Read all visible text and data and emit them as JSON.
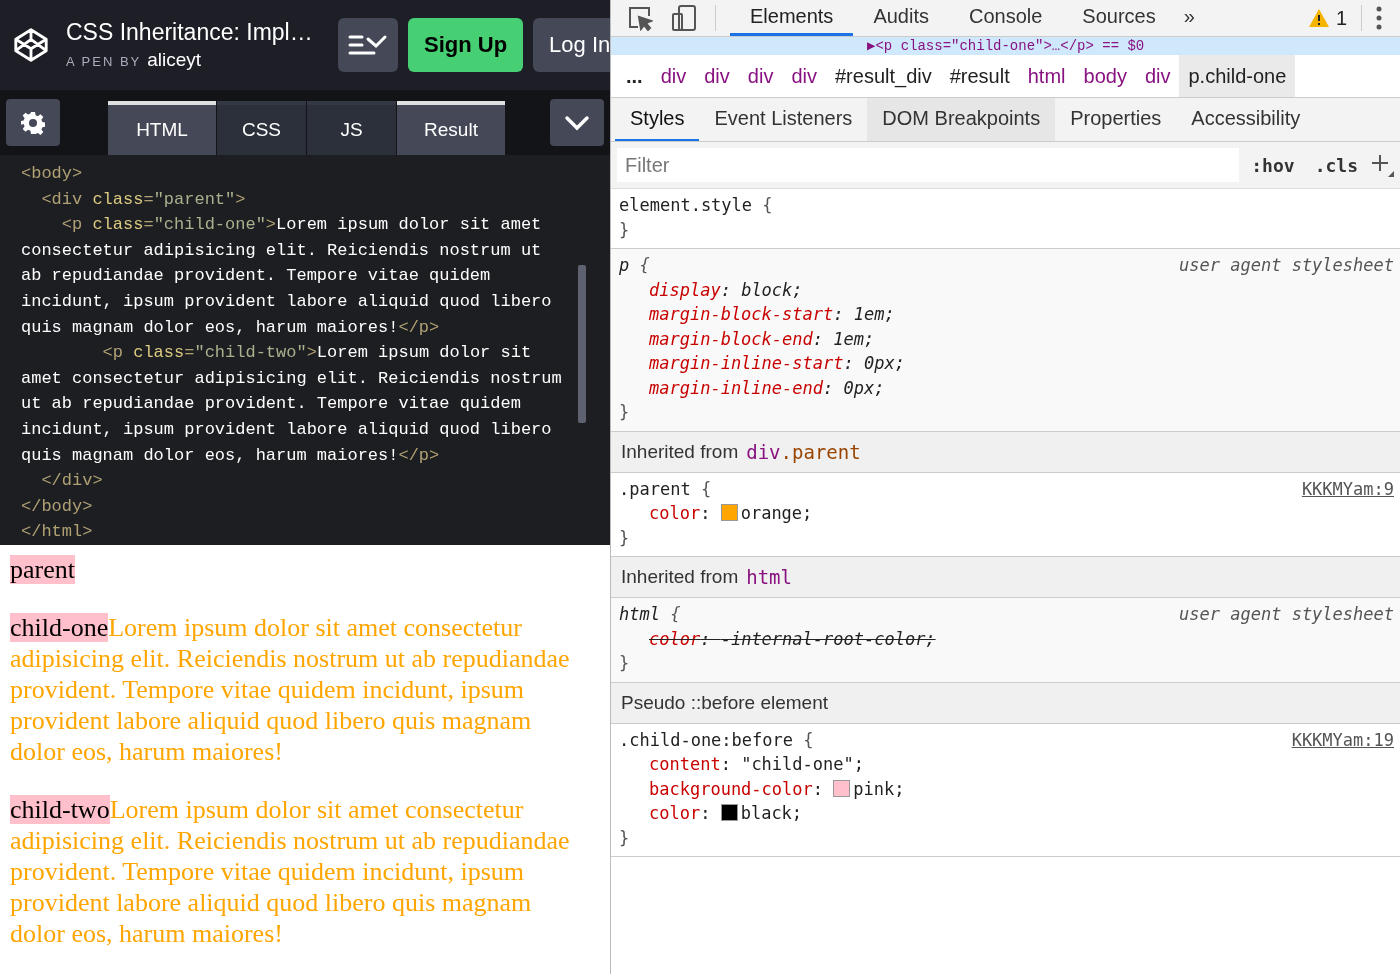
{
  "pen": {
    "title": "CSS Inheritance: Impl…",
    "byline": "A PEN BY",
    "author": "aliceyt"
  },
  "header_buttons": [
    {
      "kind": "layout"
    },
    {
      "kind": "signup",
      "label": "Sign Up"
    },
    {
      "kind": "login",
      "label": "Log In"
    }
  ],
  "editor_tabs": [
    {
      "label": "HTML",
      "selected": true
    },
    {
      "label": "CSS",
      "selected": false
    },
    {
      "label": "JS",
      "selected": false
    },
    {
      "label": "Result",
      "selected": true
    }
  ],
  "code_lines": [
    [
      {
        "kind": "tag",
        "text": "<body>"
      }
    ],
    [
      {
        "kind": "tag",
        "text": "  <div "
      },
      {
        "kind": "attr",
        "text": "class"
      },
      {
        "kind": "tag",
        "text": "="
      },
      {
        "kind": "value",
        "text": "\"parent\""
      },
      {
        "kind": "tag",
        "text": ">"
      }
    ],
    [
      {
        "kind": "tag",
        "text": "    <p "
      },
      {
        "kind": "attr",
        "text": "class"
      },
      {
        "kind": "tag",
        "text": "="
      },
      {
        "kind": "value",
        "text": "\"child-one\""
      },
      {
        "kind": "tag",
        "text": ">"
      },
      {
        "kind": "text",
        "text": "Lorem ipsum dolor sit amet"
      }
    ],
    [
      {
        "kind": "text",
        "text": "consectetur adipisicing elit. Reiciendis nostrum ut"
      }
    ],
    [
      {
        "kind": "text",
        "text": "ab repudiandae provident. Tempore vitae quidem"
      }
    ],
    [
      {
        "kind": "text",
        "text": "incidunt, ipsum provident labore aliquid quod libero"
      }
    ],
    [
      {
        "kind": "text",
        "text": "quis magnam dolor eos, harum maiores!"
      },
      {
        "kind": "tag",
        "text": "</p>"
      }
    ],
    [
      {
        "kind": "tag",
        "text": "        <p "
      },
      {
        "kind": "attr",
        "text": "class"
      },
      {
        "kind": "tag",
        "text": "="
      },
      {
        "kind": "value",
        "text": "\"child-two\""
      },
      {
        "kind": "tag",
        "text": ">"
      },
      {
        "kind": "text",
        "text": "Lorem ipsum dolor sit"
      }
    ],
    [
      {
        "kind": "text",
        "text": "amet consectetur adipisicing elit. Reiciendis nostrum"
      }
    ],
    [
      {
        "kind": "text",
        "text": "ut ab repudiandae provident. Tempore vitae quidem"
      }
    ],
    [
      {
        "kind": "text",
        "text": "incidunt, ipsum provident labore aliquid quod libero"
      }
    ],
    [
      {
        "kind": "text",
        "text": "quis magnam dolor eos, harum maiores!"
      },
      {
        "kind": "tag",
        "text": "</p>"
      }
    ],
    [
      {
        "kind": "tag",
        "text": "  </div>"
      }
    ],
    [
      {
        "kind": "tag",
        "text": "</body>"
      }
    ],
    [
      {
        "kind": "tag",
        "text": "</html>"
      }
    ]
  ],
  "result": {
    "parent_label": "parent",
    "paragraphs": [
      {
        "label": "child-one",
        "text": "Lorem ipsum dolor sit amet consectetur adipisicing elit. Reiciendis nostrum ut ab repudiandae provident. Tempore vitae quidem incidunt, ipsum provident labore aliquid quod libero quis magnam dolor eos, harum maiores!"
      },
      {
        "label": "child-two",
        "text": "Lorem ipsum dolor sit amet consectetur adipisicing elit. Reiciendis nostrum ut ab repudiandae provident. Tempore vitae quidem incidunt, ipsum provident labore aliquid quod libero quis magnam dolor eos, harum maiores!"
      }
    ]
  },
  "devtools": {
    "tabs": [
      {
        "label": "Elements",
        "selected": true
      },
      {
        "label": "Audits",
        "selected": false
      },
      {
        "label": "Console",
        "selected": false
      },
      {
        "label": "Sources",
        "selected": false
      }
    ],
    "more_tabs": "»",
    "warning_count": "1",
    "dom_line": "▶<p class=\"child-one\">…</p> == $0",
    "breadcrumbs": [
      {
        "kind": "more",
        "label": "...",
        "selected": false
      },
      {
        "kind": "tag",
        "label": "div",
        "selected": false
      },
      {
        "kind": "tag",
        "label": "div",
        "selected": false
      },
      {
        "kind": "tag",
        "label": "div",
        "selected": false
      },
      {
        "kind": "tag",
        "label": "div",
        "selected": false
      },
      {
        "kind": "id",
        "label": "#result_div",
        "selected": false
      },
      {
        "kind": "id",
        "label": "#result",
        "selected": false
      },
      {
        "kind": "tag",
        "label": "html",
        "selected": false
      },
      {
        "kind": "tag",
        "label": "body",
        "selected": false
      },
      {
        "kind": "tag",
        "label": "div",
        "selected": false
      },
      {
        "kind": "id",
        "label": "p.child-one",
        "selected": true
      }
    ],
    "subtabs": [
      {
        "label": "Styles",
        "selected": true,
        "hovered": false
      },
      {
        "label": "Event Listeners",
        "selected": false,
        "hovered": false
      },
      {
        "label": "DOM Breakpoints",
        "selected": false,
        "hovered": true
      },
      {
        "label": "Properties",
        "selected": false,
        "hovered": false
      },
      {
        "label": "Accessibility",
        "selected": false,
        "hovered": false
      }
    ],
    "filter": {
      "placeholder": "Filter",
      "hov": ":hov",
      "cls": ".cls"
    },
    "sections": [
      {
        "kind": "rule",
        "user_agent": false,
        "selector": "element.style",
        "open": "{",
        "close": "}"
      },
      {
        "kind": "rule",
        "user_agent": true,
        "selector": "p",
        "open": "{",
        "close": "}",
        "source": "user agent stylesheet",
        "declarations": [
          {
            "prop": "display",
            "colon": ":",
            "value": "block;",
            "struck": false
          },
          {
            "prop": "margin-block-start",
            "colon": ":",
            "value": "1em;",
            "struck": false
          },
          {
            "prop": "margin-block-end",
            "colon": ":",
            "value": "1em;",
            "struck": false
          },
          {
            "prop": "margin-inline-start",
            "colon": ":",
            "value": "0px;",
            "struck": false
          },
          {
            "prop": "margin-inline-end",
            "colon": ":",
            "value": "0px;",
            "struck": false
          }
        ]
      },
      {
        "kind": "header",
        "label": "Inherited from",
        "element": "div",
        "cls": ".parent"
      },
      {
        "kind": "rule",
        "user_agent": false,
        "selector": ".parent",
        "open": "{",
        "close": "}",
        "source": "KKKMYam:9",
        "declarations": [
          {
            "prop": "color",
            "colon": ":",
            "value": "orange;",
            "color": "#ffa500",
            "struck": false
          }
        ]
      },
      {
        "kind": "header",
        "label": "Inherited from",
        "element": "html"
      },
      {
        "kind": "rule",
        "user_agent": true,
        "selector": "html",
        "open": "{",
        "close": "}",
        "source": "user agent stylesheet",
        "declarations": [
          {
            "prop": "color",
            "colon": ":",
            "value": "-internal-root-color;",
            "struck": true
          }
        ]
      },
      {
        "kind": "header",
        "label": "Pseudo ::before element"
      },
      {
        "kind": "rule",
        "user_agent": false,
        "selector": ".child-one:before",
        "open": "{",
        "close": "}",
        "source": "KKKMYam:19",
        "declarations": [
          {
            "prop": "content",
            "colon": ":",
            "value": "\"child-one\";",
            "struck": false
          },
          {
            "prop": "background-color",
            "colon": ":",
            "value": "pink;",
            "color": "#ffc0cb",
            "struck": false
          },
          {
            "prop": "color",
            "colon": ":",
            "value": "black;",
            "color": "#000000",
            "struck": false
          }
        ]
      }
    ]
  }
}
